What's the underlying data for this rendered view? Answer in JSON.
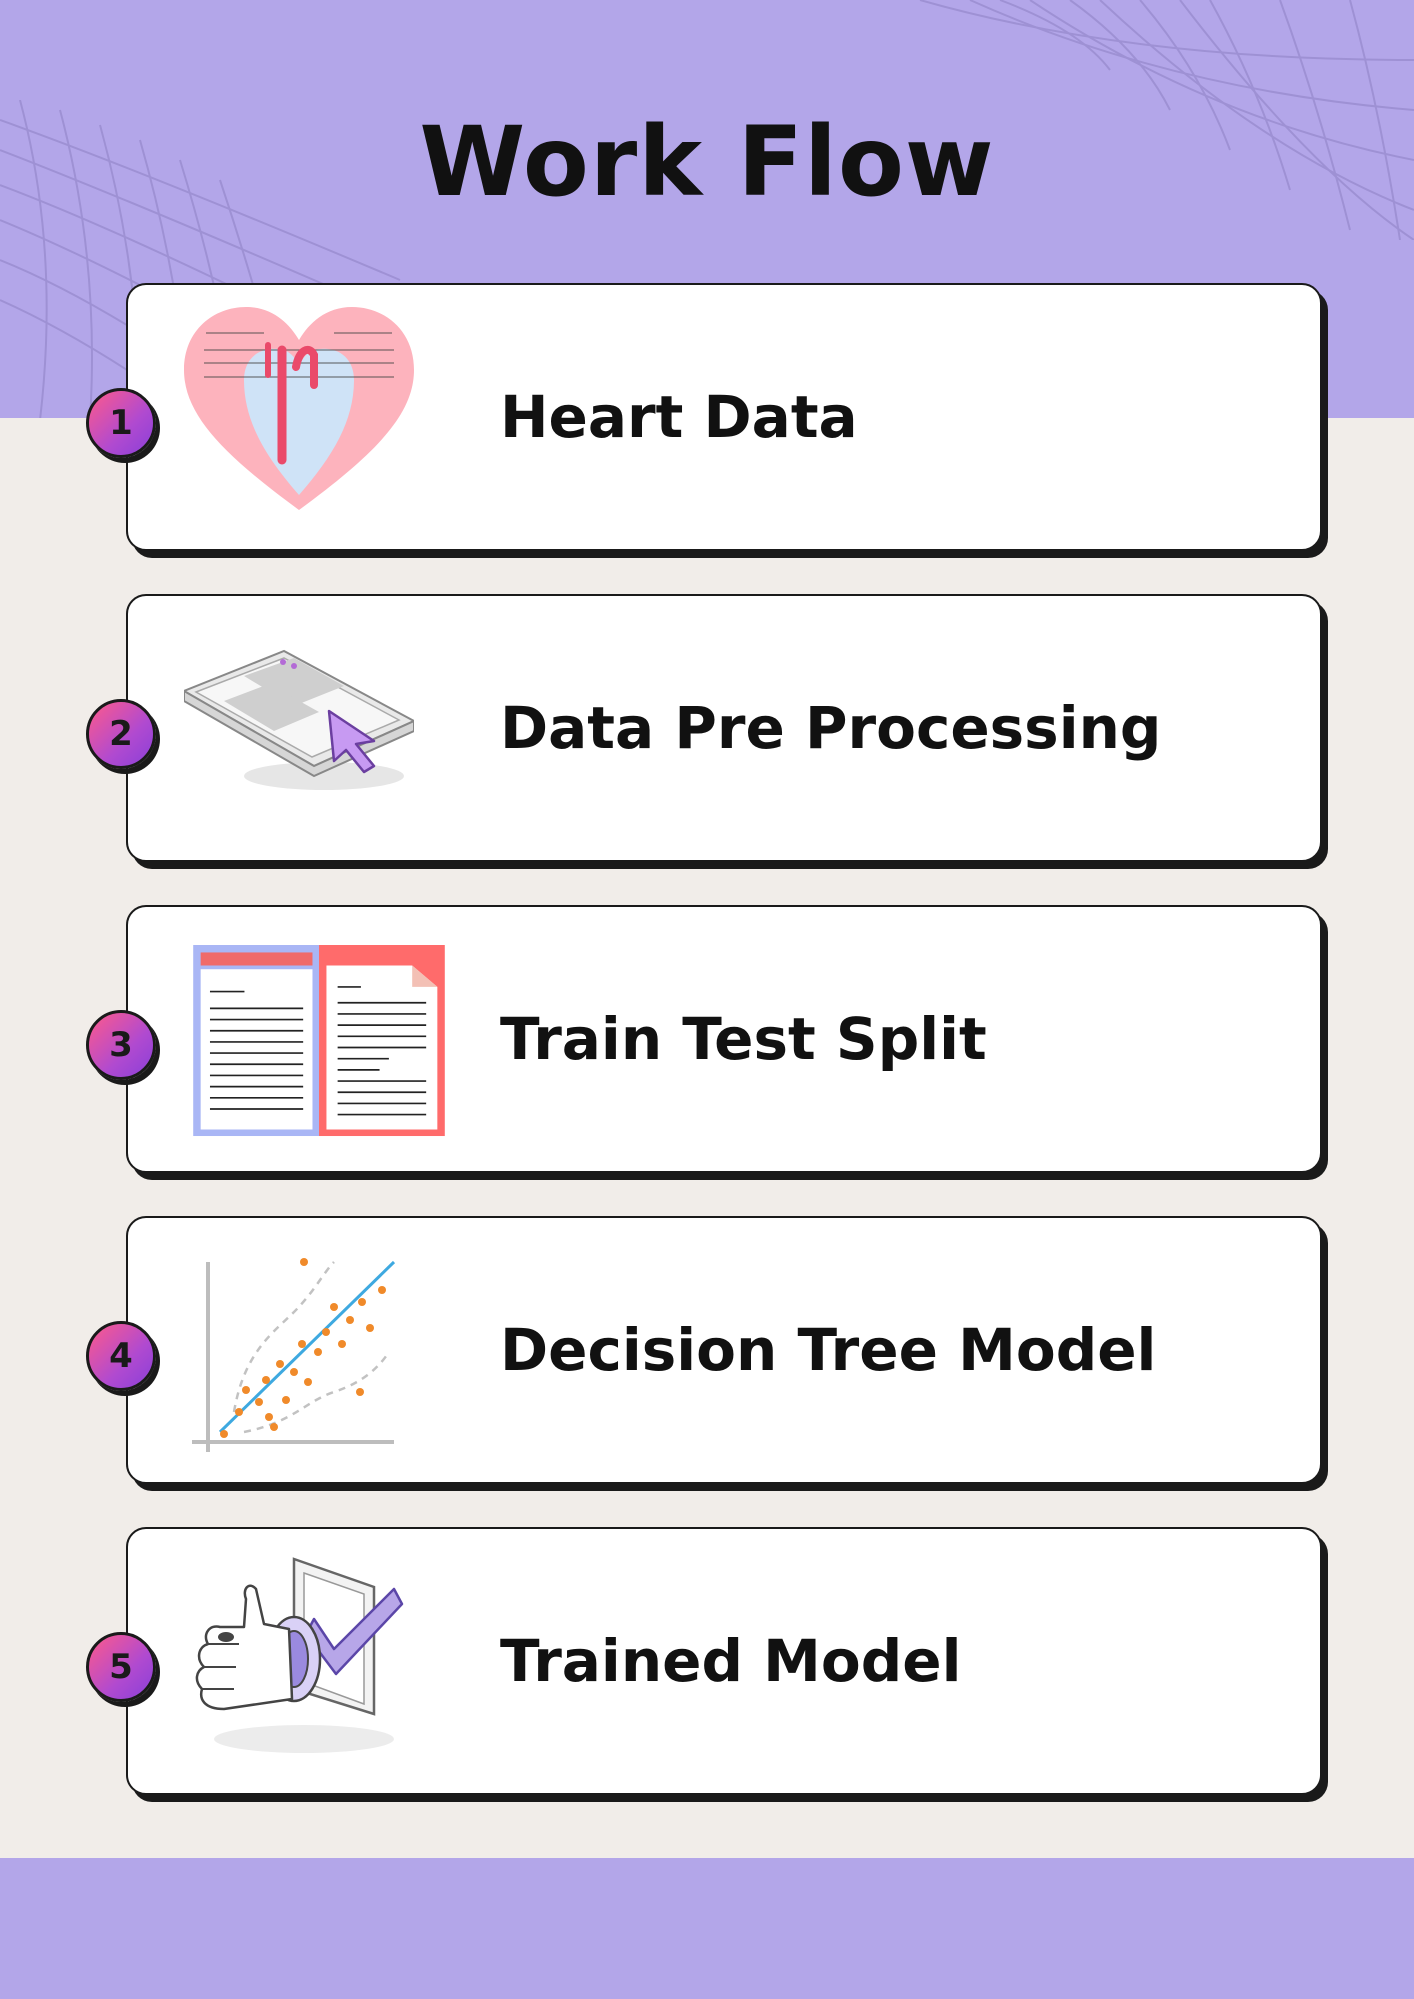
{
  "title": "Work Flow",
  "colors": {
    "band": "#b3a6e9",
    "background": "#f1ede9",
    "card": "#ffffff",
    "outline": "#1a1a1a",
    "badge_gradient": [
      "#ff5a8a",
      "#8a3fd8"
    ]
  },
  "steps": [
    {
      "number": "1",
      "label": "Heart Data",
      "icon": "heart-icon"
    },
    {
      "number": "2",
      "label": "Data Pre Processing",
      "icon": "tablet-cursor-icon"
    },
    {
      "number": "3",
      "label": "Train Test Split",
      "icon": "split-documents-icon"
    },
    {
      "number": "4",
      "label": "Decision Tree Model",
      "icon": "scatter-regression-icon"
    },
    {
      "number": "5",
      "label": "Trained Model",
      "icon": "thumbs-up-check-icon"
    }
  ]
}
